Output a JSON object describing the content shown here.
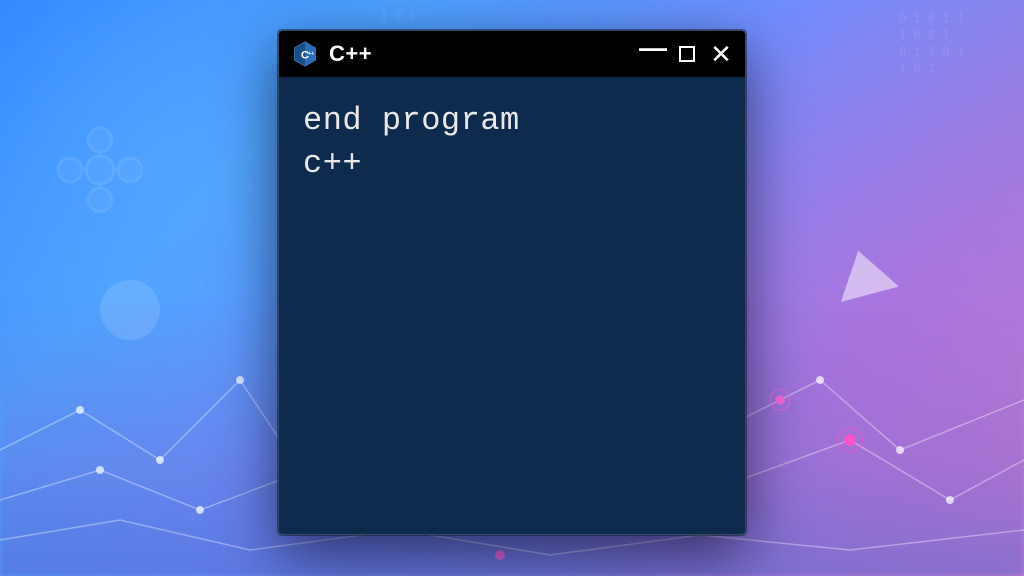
{
  "window": {
    "title": "C++",
    "icon_name": "cpp-icon"
  },
  "content": {
    "line1": "end program",
    "line2": "c++"
  },
  "controls": {
    "minimize": "—",
    "close": "✕"
  },
  "colors": {
    "window_bg": "#0e2a4d",
    "titlebar_bg": "#000000",
    "text": "#e8e8e8"
  }
}
